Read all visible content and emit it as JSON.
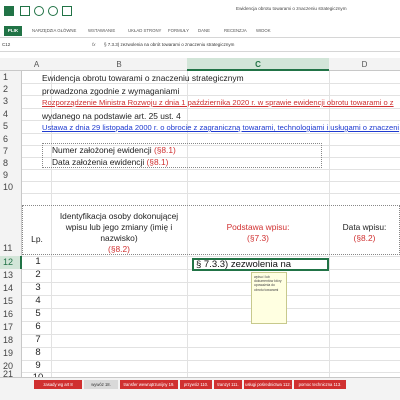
{
  "title": "Ewidencja obrotu towarami o znaczeniu strategicznym",
  "ribbon_tabs": [
    "PLIK",
    "NARZĘDZIA GŁÓWNE",
    "WSTAWIANIE",
    "UKŁAD STRONY",
    "FORMUŁY",
    "DANE",
    "RECENZJA",
    "WIDOK"
  ],
  "name_box": "C12",
  "fx_label": "fx",
  "formula": "§ 7.3.3) zezwolenia na obrót towarami o znaczeniu strategicznym",
  "columns": [
    "A",
    "B",
    "C",
    "D"
  ],
  "rows": [
    "1",
    "2",
    "3",
    "4",
    "5",
    "6",
    "7",
    "8",
    "9",
    "10",
    "11",
    "12",
    "13",
    "14",
    "15",
    "16",
    "17",
    "18",
    "19",
    "20",
    "21"
  ],
  "selected_row": "12",
  "selected_column": "C",
  "header": {
    "line1": "Ewidencja obrotu towarami o znaczeniu strategicznym",
    "line2": "prowadzona zgodnie z wymaganiami",
    "line3": "Rozporządzenie Ministra Rozwoju z dnia 1 października 2020 r. w sprawie ewidencji obrotu towarami o z",
    "line4": "wydanego na podstawie art. 25 ust. 4",
    "line5": "Ustawa z dnia 29 listopada 2000 r. o obrocie z zagraniczną towarami, technologiami i usługami o znaczeni"
  },
  "fields": {
    "record_number_label": "Numer założonej ewidencji",
    "record_number_ref": "(§8.1)",
    "record_date_label": "Data założenia ewidencji",
    "record_date_ref": "(§8.1)"
  },
  "table_headers": {
    "lp": "Lp.",
    "identification_line1": "Identyfikacja osoby dokonującej",
    "identification_line2": "wpisu lub jego zmiany (imię i",
    "identification_line3": "nazwisko)",
    "identification_ref": "(§8.2)",
    "basis_line1": "Podstawa wpisu:",
    "basis_ref": "(§7.3)",
    "date_line1": "Data wpisu:",
    "date_ref": "(§8.2)"
  },
  "numbers": [
    "1",
    "2",
    "3",
    "4",
    "5",
    "6",
    "7",
    "8",
    "9",
    "10"
  ],
  "active_cell_text": "§ 7.3.3) zezwolenia na",
  "comment_text": "wpisu i lub dokumentów który upoważnia do obrotu towarami",
  "sheet_tabs": [
    {
      "label": "zasady wg art 8",
      "color": "#d03030"
    },
    {
      "label": "wywóz 18.",
      "color": "#d9d9d9",
      "text": "#333333"
    },
    {
      "label": "transfer wewnątrzunijny 19.",
      "color": "#d03030"
    },
    {
      "label": "przywóz 110.",
      "color": "#d03030"
    },
    {
      "label": "tranzyt 111.",
      "color": "#d03030"
    },
    {
      "label": "usługi pośrednictwa 112.",
      "color": "#d03030"
    },
    {
      "label": "pomoc techniczna 113.",
      "color": "#d03030"
    }
  ],
  "accent_color": "#217346"
}
